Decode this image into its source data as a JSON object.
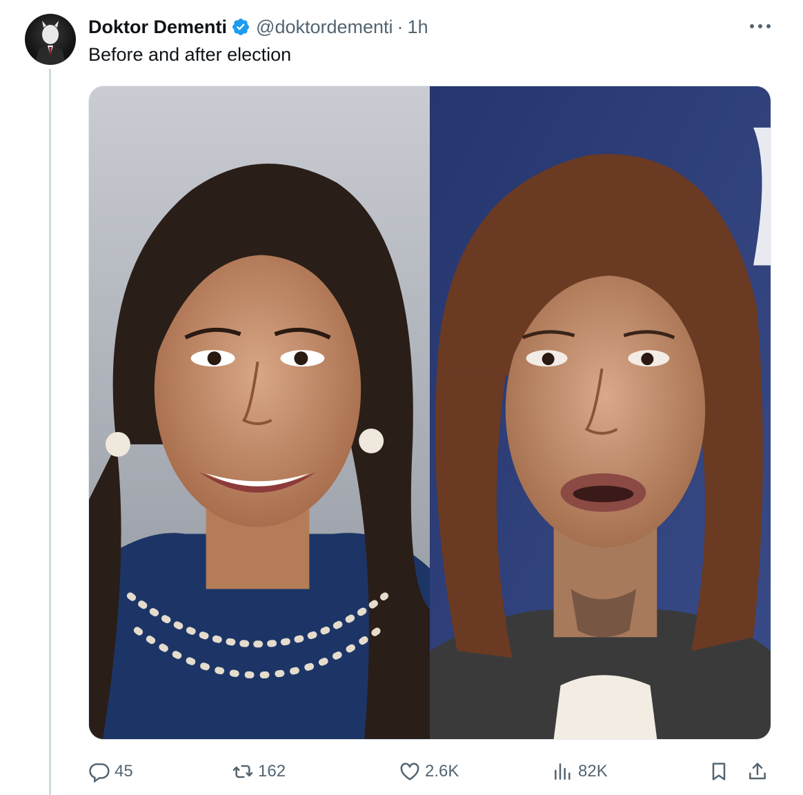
{
  "author": {
    "display_name": "Doktor Dementi",
    "handle": "@doktordementi",
    "separator": "·",
    "time": "1h",
    "verified": true
  },
  "tweet": {
    "text": "Before and after election"
  },
  "actions": {
    "replies": "45",
    "reposts": "162",
    "likes": "2.6K",
    "views": "82K"
  },
  "colors": {
    "text_primary": "#0f1419",
    "text_secondary": "#536471",
    "verified_blue": "#1d9bf0",
    "thread_line": "#cfd9de"
  },
  "icons": {
    "reply": "reply-icon",
    "repost": "repost-icon",
    "like": "heart-icon",
    "views": "views-chart-icon",
    "bookmark": "bookmark-icon",
    "share": "share-icon",
    "more": "more-dots-icon",
    "verified": "verified-badge-icon"
  }
}
